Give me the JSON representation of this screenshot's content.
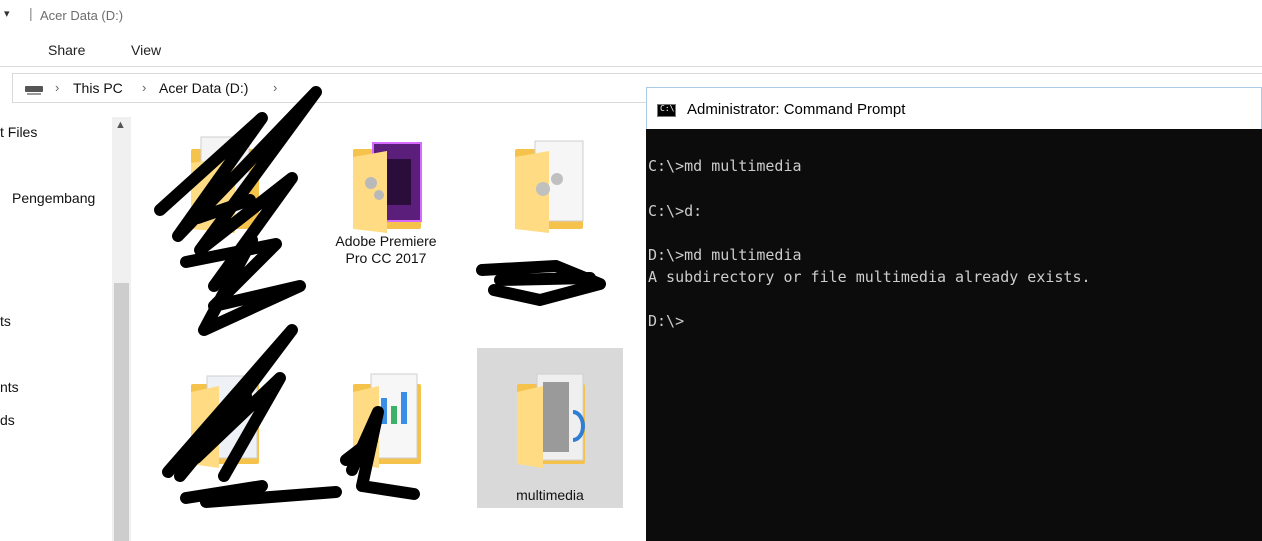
{
  "explorer": {
    "title": "Acer Data (D:)",
    "quick_access_glyph": "▾",
    "ribbon_tabs": {
      "share": "Share",
      "view": "View"
    },
    "breadcrumb": {
      "this_pc": "This PC",
      "drive": "Acer Data (D:)",
      "separator": "›"
    },
    "nav_items": [
      "t Files",
      "Pengembang",
      "ts",
      "nts",
      "ds"
    ],
    "folders": [
      {
        "label": "",
        "kind": "plain"
      },
      {
        "label": "Adobe Premiere Pro CC 2017",
        "kind": "premiere"
      },
      {
        "label": "",
        "kind": "plain"
      },
      {
        "label": "",
        "kind": "app"
      },
      {
        "label": "",
        "kind": "docs"
      },
      {
        "label": "multimedia",
        "kind": "docs",
        "selected": true
      }
    ]
  },
  "cmd": {
    "title": "Administrator: Command Prompt",
    "icon_text": "C:\\",
    "lines": [
      "C:\\>md multimedia",
      "",
      "C:\\>d:",
      "",
      "D:\\>md multimedia",
      "A subdirectory or file multimedia already exists.",
      "",
      "D:\\>"
    ]
  },
  "colors": {
    "folder": "#f5c24c",
    "folder_light": "#ffdc84",
    "premiere": "#5b1e7a",
    "console_bg": "#0c0c0c",
    "console_text": "#cccccc",
    "selected_tile": "#d9d9d9"
  }
}
